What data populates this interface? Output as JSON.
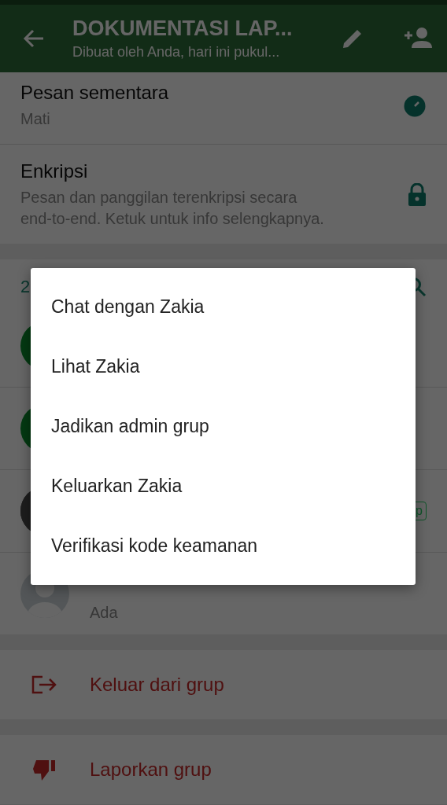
{
  "header": {
    "title": "DOKUMENTASI LAP...",
    "subtitle": "Dibuat oleh Anda, hari ini pukul..."
  },
  "settings": [
    {
      "kind": "timer",
      "title": "Pesan sementara",
      "subtitle": "Mati"
    },
    {
      "kind": "lock",
      "title": "Enkripsi",
      "subtitle": "Pesan dan panggilan terenkripsi secara end-to-end. Ketuk untuk info selengkapnya."
    }
  ],
  "participants": {
    "count": "2",
    "members": [
      {
        "kind": "green"
      },
      {
        "kind": "green"
      },
      {
        "badge": "p"
      },
      {
        "kind": "default",
        "status": "Ada"
      }
    ]
  },
  "actions": [
    {
      "kind": "exit",
      "label": "Keluar dari grup"
    },
    {
      "kind": "report",
      "label": "Laporkan grup"
    }
  ],
  "dialog": {
    "items": [
      "Chat dengan Zakia",
      "Lihat Zakia",
      "Jadikan admin grup",
      "Keluarkan Zakia",
      "Verifikasi kode keamanan"
    ]
  }
}
